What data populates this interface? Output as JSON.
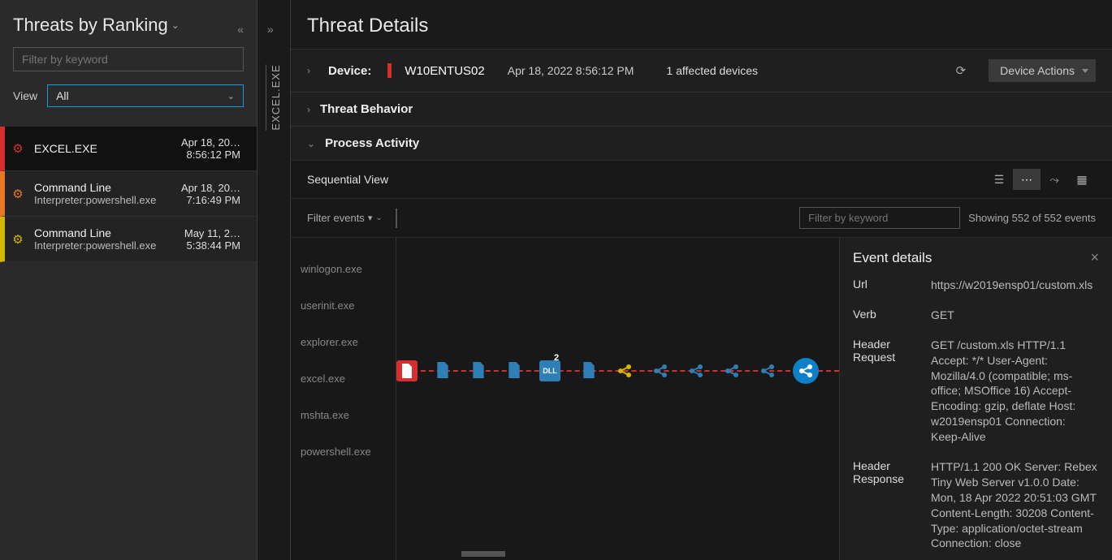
{
  "sidebar": {
    "title": "Threats by Ranking",
    "filter_placeholder": "Filter by keyword",
    "view_label": "View",
    "view_value": "All",
    "threats": [
      {
        "name": "EXCEL.EXE",
        "sub": "",
        "date": "Apr 18, 20…",
        "time": "8:56:12 PM",
        "severity": "red"
      },
      {
        "name": "Command Line",
        "sub": "Interpreter:powershell.exe",
        "date": "Apr 18, 20…",
        "time": "7:16:49 PM",
        "severity": "orange"
      },
      {
        "name": "Command Line",
        "sub": "Interpreter:powershell.exe",
        "date": "May 11, 2…",
        "time": "5:38:44 PM",
        "severity": "yellow"
      }
    ]
  },
  "vtab_label": "EXCEL.EXE",
  "main": {
    "title": "Threat Details",
    "device_label": "Device:",
    "device_name": "W10ENTUS02",
    "device_time": "Apr 18, 2022 8:56:12 PM",
    "affected": "1 affected devices",
    "actions_button": "Device Actions",
    "behavior_label": "Threat Behavior",
    "process_activity_label": "Process Activity",
    "sequential_label": "Sequential View",
    "filter_events_label": "Filter events",
    "filter_kw_placeholder": "Filter by keyword",
    "showing": "Showing 552 of 552 events"
  },
  "processes": [
    "winlogon.exe",
    "userinit.exe",
    "explorer.exe",
    "excel.exe",
    "mshta.exe",
    "powershell.exe"
  ],
  "timeline_badge": "2",
  "details": {
    "title": "Event details",
    "url_k": "Url",
    "url_v": "https://w2019ensp01/custom.xls",
    "verb_k": "Verb",
    "verb_v": "GET",
    "hreq_k": "Header Request",
    "hreq_v": "GET /custom.xls HTTP/1.1 Accept: */* User-Agent: Mozilla/4.0 (compatible; ms-office; MSOffice 16) Accept-Encoding: gzip, deflate Host: w2019ensp01 Connection: Keep-Alive",
    "hres_k": "Header Response",
    "hres_v": "HTTP/1.1 200 OK Server: Rebex Tiny Web Server v1.0.0 Date: Mon, 18 Apr 2022 20:51:03 GMT Content-Length: 30208 Content-Type: application/octet-stream Connection: close"
  }
}
